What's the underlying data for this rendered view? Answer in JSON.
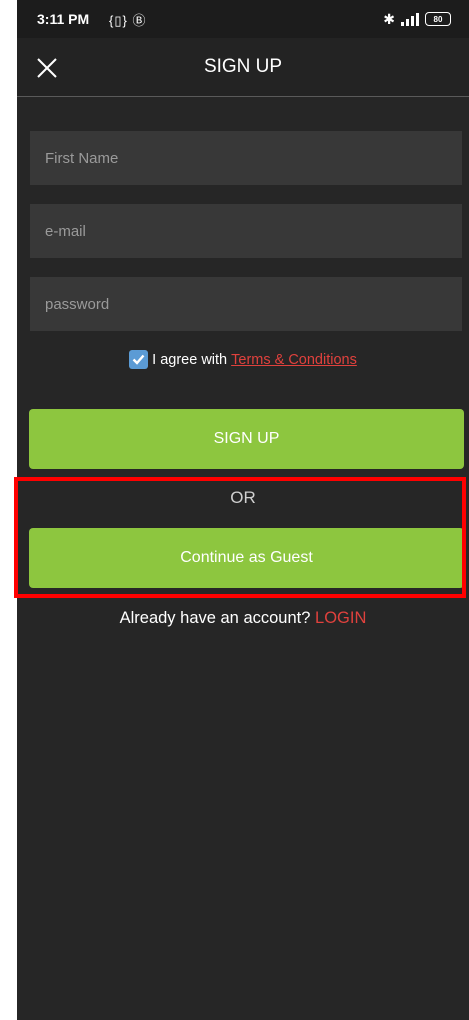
{
  "status_bar": {
    "time": "3:11 PM",
    "left_icons": "{▯} Ⓑ",
    "battery": "80"
  },
  "app_bar": {
    "title": "SIGN UP",
    "close_icon": "close-icon"
  },
  "form": {
    "first_name_placeholder": "First Name",
    "email_placeholder": "e-mail",
    "password_placeholder": "password",
    "agree_text": "I agree with",
    "terms_link": "Terms & Conditions",
    "agree_checked": true,
    "signup_button": "SIGN UP",
    "or_text": "OR",
    "guest_button": "Continue as Guest",
    "already_text": "Already have an account?",
    "login_link": "LOGIN"
  },
  "colors": {
    "accent_green": "#8dc63f",
    "link_red": "#e0413d",
    "highlight": "#ff0000",
    "checkbox_blue": "#5b9bd5"
  }
}
